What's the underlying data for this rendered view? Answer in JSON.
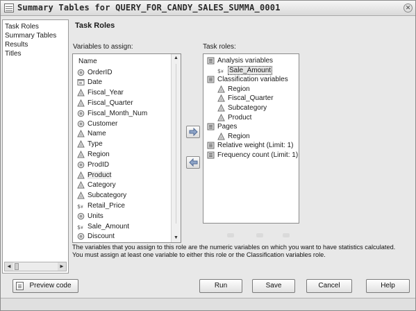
{
  "window": {
    "title": "Summary Tables for QUERY_FOR_CANDY_SALES_SUMMA_0001"
  },
  "nav": {
    "items": [
      "Task Roles",
      "Summary Tables",
      "Results",
      "Titles"
    ],
    "selected": "Task Roles"
  },
  "panel": {
    "title": "Task Roles",
    "vars_label": "Variables to assign:",
    "roles_label": "Task roles:"
  },
  "variables": {
    "header": "Name",
    "items": [
      {
        "name": "OrderID",
        "icon": "numeric-icon"
      },
      {
        "name": "Date",
        "icon": "date-icon"
      },
      {
        "name": "Fiscal_Year",
        "icon": "character-icon"
      },
      {
        "name": "Fiscal_Quarter",
        "icon": "character-icon"
      },
      {
        "name": "Fiscal_Month_Num",
        "icon": "numeric-icon"
      },
      {
        "name": "Customer",
        "icon": "numeric-icon"
      },
      {
        "name": "Name",
        "icon": "character-icon"
      },
      {
        "name": "Type",
        "icon": "character-icon"
      },
      {
        "name": "Region",
        "icon": "character-icon"
      },
      {
        "name": "ProdID",
        "icon": "numeric-icon"
      },
      {
        "name": "Product",
        "icon": "character-icon"
      },
      {
        "name": "Category",
        "icon": "character-icon"
      },
      {
        "name": "Subcategory",
        "icon": "character-icon"
      },
      {
        "name": "Retail_Price",
        "icon": "currency-icon"
      },
      {
        "name": "Units",
        "icon": "numeric-icon"
      },
      {
        "name": "Sale_Amount",
        "icon": "currency-icon"
      },
      {
        "name": "Discount",
        "icon": "numeric-icon"
      }
    ],
    "selected": "Product"
  },
  "task_roles": {
    "items": [
      {
        "label": "Analysis variables",
        "level": 0,
        "icon": "role-analysis-icon"
      },
      {
        "label": "Sale_Amount",
        "level": 1,
        "icon": "currency-icon",
        "selected": true
      },
      {
        "label": "Classification variables",
        "level": 0,
        "icon": "role-classification-icon"
      },
      {
        "label": "Region",
        "level": 1,
        "icon": "character-icon"
      },
      {
        "label": "Fiscal_Quarter",
        "level": 1,
        "icon": "character-icon"
      },
      {
        "label": "Subcategory",
        "level": 1,
        "icon": "character-icon"
      },
      {
        "label": "Product",
        "level": 1,
        "icon": "character-icon"
      },
      {
        "label": "Pages",
        "level": 0,
        "icon": "role-pages-icon"
      },
      {
        "label": "Region",
        "level": 1,
        "icon": "character-icon"
      },
      {
        "label": "Relative weight  (Limit: 1)",
        "level": 0,
        "icon": "role-weight-icon"
      },
      {
        "label": "Frequency count  (Limit: 1)",
        "level": 0,
        "icon": "role-frequency-icon"
      }
    ]
  },
  "help": {
    "line1": "The variables that you assign to this role are the numeric variables on which you want to have statistics calculated.",
    "line2": "You must assign at least one variable to either this role or the Classification variables role."
  },
  "buttons": {
    "preview": "Preview code",
    "run": "Run",
    "save": "Save",
    "cancel": "Cancel",
    "help": "Help"
  }
}
